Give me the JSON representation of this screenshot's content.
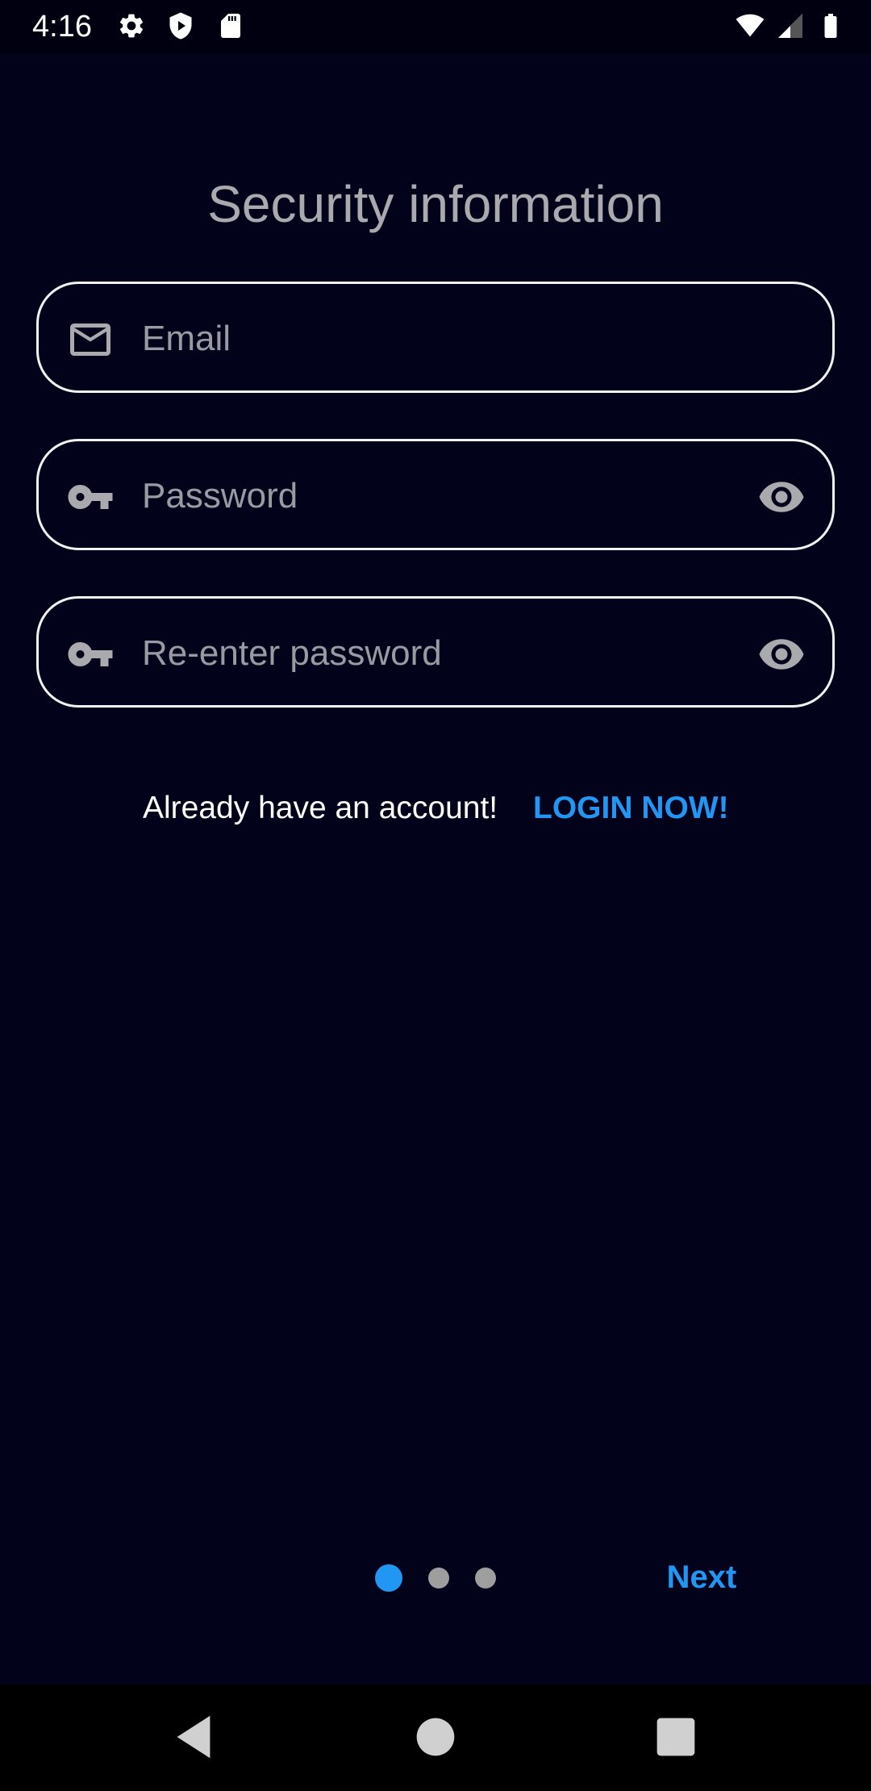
{
  "status_bar": {
    "time": "4:16",
    "left_icons": [
      "settings-icon",
      "shield-play-icon",
      "sd-card-icon"
    ],
    "right_icons": [
      "wifi-icon",
      "signal-icon",
      "battery-icon"
    ]
  },
  "title": "Security information",
  "fields": {
    "email": {
      "placeholder": "Email",
      "value": "",
      "icon": "mail-icon"
    },
    "password": {
      "placeholder": "Password",
      "value": "",
      "icon": "key-icon",
      "toggle_icon": "eye-icon"
    },
    "confirm_password": {
      "placeholder": "Re-enter password",
      "value": "",
      "icon": "key-icon",
      "toggle_icon": "eye-icon"
    }
  },
  "login_prompt": {
    "text": "Already have an account!",
    "link_label": "LOGIN NOW!"
  },
  "pager": {
    "pages": 3,
    "active_index": 0
  },
  "next_label": "Next",
  "colors": {
    "background": "#02031a",
    "accent": "#2196f3",
    "field_border": "#f2f2f2",
    "placeholder": "#9a9aa2",
    "inactive_dot": "#9e9e9e"
  },
  "nav_bar": {
    "buttons": [
      "back-icon",
      "home-icon",
      "recents-icon"
    ]
  }
}
